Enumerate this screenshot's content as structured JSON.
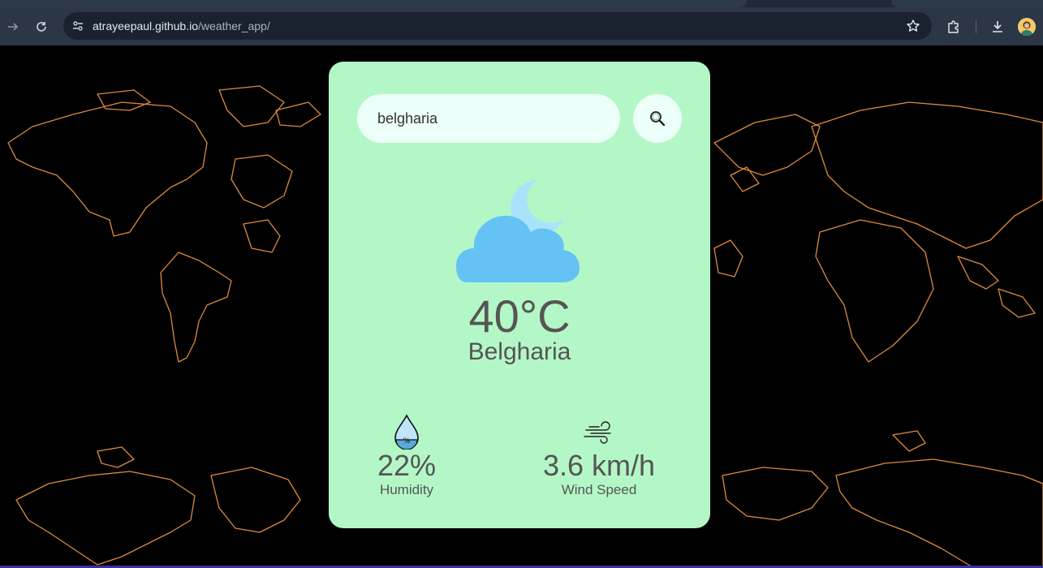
{
  "browser": {
    "url_host": "atrayeepaul.github.io",
    "url_path": "/weather_app/"
  },
  "icons": {
    "forward": "arrow-right-icon",
    "reload": "reload-icon",
    "site_info": "tune-icon",
    "bookmark": "star-icon",
    "extensions": "puzzle-icon",
    "downloads": "download-icon",
    "profile": "avatar",
    "search": "magnifier-icon",
    "weather": "cloud-moon-icon",
    "humidity": "water-drop-icon",
    "wind": "wind-icon"
  },
  "search": {
    "value": "belgharia",
    "placeholder": ""
  },
  "weather": {
    "temperature": "40°C",
    "city": "Belgharia",
    "humidity_value": "22%",
    "humidity_label": "Humidity",
    "wind_value": "3.6 km/h",
    "wind_label": "Wind Speed"
  },
  "colors": {
    "card": "#b4f7c6",
    "map_lines": "#e08a3c",
    "cloud": "#64c2f5",
    "moon": "#a9e3fb"
  }
}
